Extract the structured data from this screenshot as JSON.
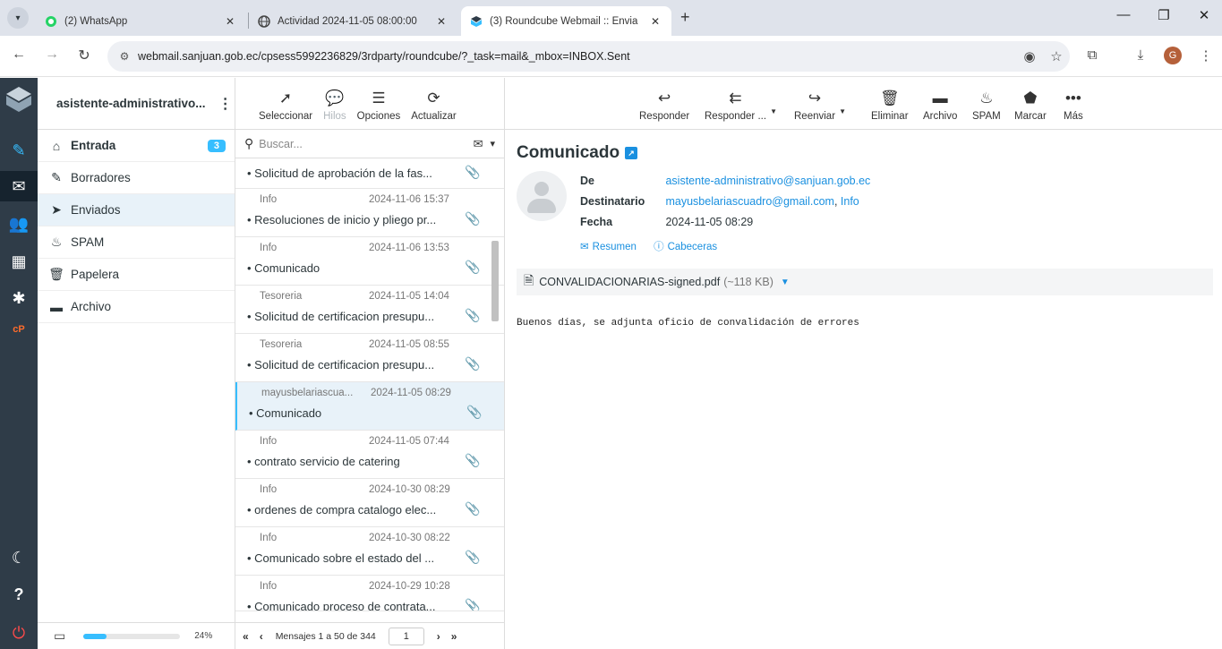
{
  "browser": {
    "tabs": [
      {
        "title": "(2) WhatsApp",
        "icon": "whatsapp-icon"
      },
      {
        "title": "Actividad 2024-11-05 08:00:00",
        "icon": "globe-icon"
      },
      {
        "title": "(3) Roundcube Webmail :: Envia",
        "icon": "roundcube-icon"
      }
    ],
    "url": "webmail.sanjuan.gob.ec/cpsess5992236829/3rdparty/roundcube/?_task=mail&_mbox=INBOX.Sent",
    "profile_initial": "G"
  },
  "account": {
    "name": "asistente-administrativo..."
  },
  "folders": [
    {
      "label": "Entrada",
      "icon": "inbox-icon",
      "badge": "3"
    },
    {
      "label": "Borradores",
      "icon": "pencil-icon"
    },
    {
      "label": "Enviados",
      "icon": "paper-plane-icon"
    },
    {
      "label": "SPAM",
      "icon": "fire-icon"
    },
    {
      "label": "Papelera",
      "icon": "trash-icon"
    },
    {
      "label": "Archivo",
      "icon": "archive-icon"
    }
  ],
  "quota": {
    "percent_label": "24%",
    "value": 0.24
  },
  "list_toolbar": {
    "select": "Seleccionar",
    "threads": "Hilos",
    "options": "Opciones",
    "refresh": "Actualizar"
  },
  "search": {
    "placeholder": "Buscar..."
  },
  "messages": [
    {
      "from": "",
      "date": "",
      "subject": "Solicitud de aprobación de la fas..."
    },
    {
      "from": "Info",
      "date": "2024-11-06 15:37",
      "subject": "Resoluciones de inicio y pliego pr..."
    },
    {
      "from": "Info",
      "date": "2024-11-06 13:53",
      "subject": "Comunicado"
    },
    {
      "from": "Tesoreria",
      "date": "2024-11-05 14:04",
      "subject": "Solicitud de certificacion presupu..."
    },
    {
      "from": "Tesoreria",
      "date": "2024-11-05 08:55",
      "subject": "Solicitud de certificacion presupu..."
    },
    {
      "from": "mayusbelariascua...",
      "date": "2024-11-05 08:29",
      "subject": "Comunicado"
    },
    {
      "from": "Info",
      "date": "2024-11-05 07:44",
      "subject": "contrato servicio de catering"
    },
    {
      "from": "Info",
      "date": "2024-10-30 08:29",
      "subject": "ordenes de compra catalogo elec..."
    },
    {
      "from": "Info",
      "date": "2024-10-30 08:22",
      "subject": "Comunicado sobre el estado del ..."
    },
    {
      "from": "Info",
      "date": "2024-10-29 10:28",
      "subject": "Comunicado proceso de contrata..."
    }
  ],
  "pagination": {
    "text": "Mensajes 1 a 50 de 344",
    "page": "1"
  },
  "content_toolbar": {
    "reply": "Responder",
    "reply_all": "Responder ...",
    "forward": "Reenviar",
    "delete": "Eliminar",
    "archive": "Archivo",
    "spam": "SPAM",
    "mark": "Marcar",
    "more": "Más"
  },
  "email": {
    "subject": "Comunicado",
    "from_label": "De",
    "from": "asistente-administrativo@sanjuan.gob.ec",
    "to_label": "Destinatario",
    "to": "mayusbelariascuadro@gmail.com",
    "to_extra": "Info",
    "date_label": "Fecha",
    "date": "2024-11-05 08:29",
    "summary_link": "Resumen",
    "headers_link": "Cabeceras",
    "attachment_name": "CONVALIDACIONARIAS-signed.pdf",
    "attachment_size": "(~118 KB)",
    "body": "Buenos días, se adjunta oficio de convalidación de errores"
  }
}
